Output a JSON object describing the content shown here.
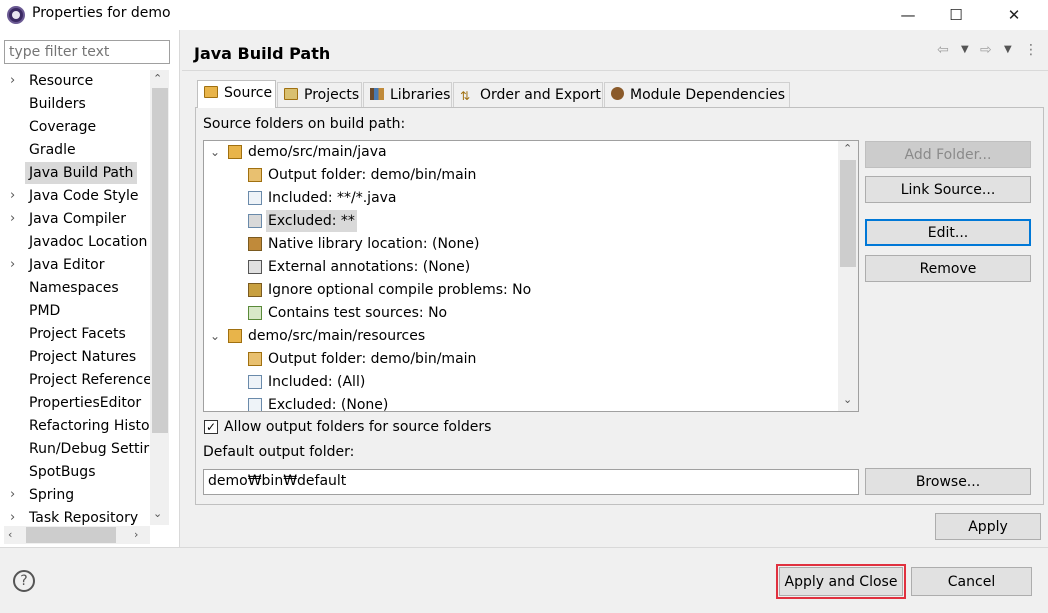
{
  "window": {
    "title": "Properties for demo",
    "minimize_glyph": "—",
    "maximize_glyph": "☐",
    "close_glyph": "✕"
  },
  "sidebar": {
    "filter_placeholder": "type filter text",
    "items": [
      {
        "label": "Resource",
        "expandable": true
      },
      {
        "label": "Builders",
        "expandable": false
      },
      {
        "label": "Coverage",
        "expandable": false
      },
      {
        "label": "Gradle",
        "expandable": false
      },
      {
        "label": "Java Build Path",
        "expandable": false,
        "selected": true
      },
      {
        "label": "Java Code Style",
        "expandable": true
      },
      {
        "label": "Java Compiler",
        "expandable": true
      },
      {
        "label": "Javadoc Location",
        "expandable": false
      },
      {
        "label": "Java Editor",
        "expandable": true
      },
      {
        "label": "Namespaces",
        "expandable": false
      },
      {
        "label": "PMD",
        "expandable": false
      },
      {
        "label": "Project Facets",
        "expandable": false
      },
      {
        "label": "Project Natures",
        "expandable": false
      },
      {
        "label": "Project Reference",
        "expandable": false
      },
      {
        "label": "PropertiesEditor",
        "expandable": false
      },
      {
        "label": "Refactoring Histor",
        "expandable": false
      },
      {
        "label": "Run/Debug Settir",
        "expandable": false
      },
      {
        "label": "SpotBugs",
        "expandable": false
      },
      {
        "label": "Spring",
        "expandable": true
      },
      {
        "label": "Task Repository",
        "expandable": true
      }
    ]
  },
  "header": {
    "title": "Java Build Path"
  },
  "tabs": [
    {
      "label": "Source",
      "icon": "source-folder-icon",
      "active": true
    },
    {
      "label": "Projects",
      "icon": "projects-icon",
      "active": false
    },
    {
      "label": "Libraries",
      "icon": "libraries-icon",
      "active": false
    },
    {
      "label": "Order and Export",
      "icon": "order-export-icon",
      "active": false
    },
    {
      "label": "Module Dependencies",
      "icon": "module-icon",
      "active": false
    }
  ],
  "source": {
    "list_label": "Source folders on build path:",
    "tree": [
      {
        "label": "demo/src/main/java",
        "level": 0,
        "icon": "package-folder-icon",
        "expanded": true
      },
      {
        "label": "Output folder: demo/bin/main",
        "level": 1,
        "icon": "output-folder-icon"
      },
      {
        "label": "Included: **/*.java",
        "level": 1,
        "icon": "inclusion-filter-icon"
      },
      {
        "label": "Excluded: **",
        "level": 1,
        "icon": "exclusion-filter-icon",
        "selected": true
      },
      {
        "label": "Native library location: (None)",
        "level": 1,
        "icon": "native-library-icon"
      },
      {
        "label": "External annotations: (None)",
        "level": 1,
        "icon": "annotations-icon"
      },
      {
        "label": "Ignore optional compile problems: No",
        "level": 1,
        "icon": "ignore-problems-icon"
      },
      {
        "label": "Contains test sources: No",
        "level": 1,
        "icon": "test-sources-icon"
      },
      {
        "label": "demo/src/main/resources",
        "level": 0,
        "icon": "package-folder-icon",
        "expanded": true
      },
      {
        "label": "Output folder: demo/bin/main",
        "level": 1,
        "icon": "output-folder-icon"
      },
      {
        "label": "Included: (All)",
        "level": 1,
        "icon": "inclusion-filter-icon"
      },
      {
        "label": "Excluded: (None)",
        "level": 1,
        "icon": "exclusion-filter-icon"
      }
    ],
    "buttons": {
      "add_folder": "Add Folder...",
      "link_source": "Link Source...",
      "edit": "Edit...",
      "remove": "Remove"
    },
    "allow_output_label": "Allow output folders for source folders",
    "allow_output_checked": true,
    "default_output_label": "Default output folder:",
    "default_output_value": "demo₩bin₩default",
    "browse": "Browse..."
  },
  "footer": {
    "apply": "Apply",
    "apply_and_close": "Apply and Close",
    "cancel": "Cancel",
    "help_glyph": "?"
  },
  "colors": {
    "highlight": "#e0313f",
    "focus_border": "#0078d7",
    "selection": "#d9d9d9"
  }
}
